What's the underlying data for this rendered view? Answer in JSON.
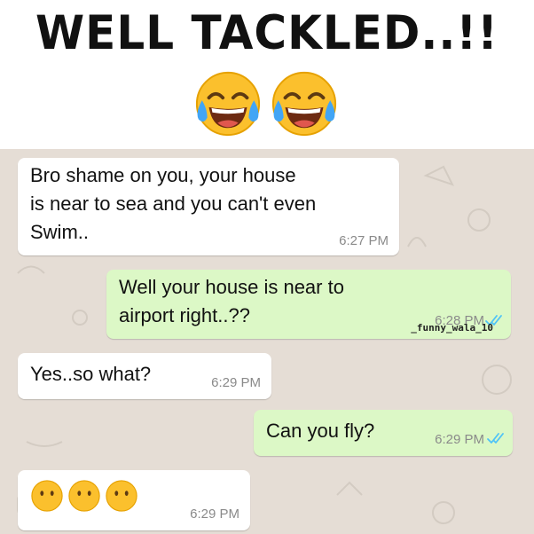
{
  "header": {
    "title": "WELL TACKLED..!!",
    "emojis": [
      "face-with-tears-of-joy-icon",
      "face-with-tears-of-joy-icon"
    ]
  },
  "chat": {
    "messages": [
      {
        "direction": "incoming",
        "lines": [
          "Bro shame on you, your house",
          "is near to sea and you can't even",
          "Swim.."
        ],
        "time": "6:27 PM"
      },
      {
        "direction": "outgoing",
        "lines": [
          "Well your house is near to",
          "airport right..??"
        ],
        "time": "6:28 PM",
        "status": "double-check-icon"
      },
      {
        "direction": "incoming",
        "lines": [
          "Yes..so what?"
        ],
        "time": "6:29 PM"
      },
      {
        "direction": "outgoing",
        "lines": [
          "Can you fly?"
        ],
        "time": "6:29 PM",
        "status": "double-check-icon"
      },
      {
        "direction": "incoming",
        "emojis": [
          "hushed-face-icon",
          "hushed-face-icon",
          "hushed-face-icon"
        ],
        "time": "6:29 PM"
      }
    ],
    "watermark": "_funny_wala_10"
  },
  "colors": {
    "chat_background": "#e5ddd5",
    "incoming_bubble": "#ffffff",
    "outgoing_bubble": "#dcf8c6",
    "read_ticks": "#4fc3f7"
  }
}
